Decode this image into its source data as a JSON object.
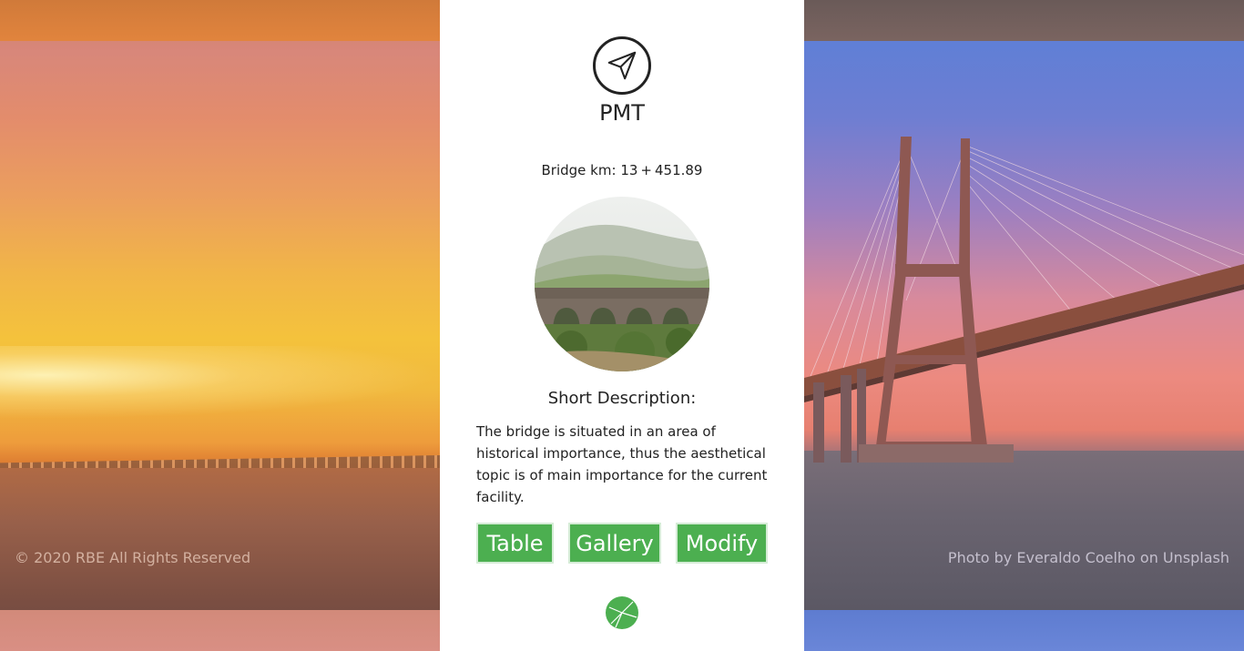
{
  "brand": {
    "name": "PMT"
  },
  "bridge": {
    "km_label": "Bridge km:",
    "km_int": "13",
    "km_sep": "+",
    "km_dec": "451.89"
  },
  "description": {
    "title": "Short Description:",
    "text": "The bridge is situated in an area of historical importance, thus the aesthetical topic is of main importance for the current facility."
  },
  "buttons": {
    "table": "Table",
    "gallery": "Gallery",
    "modify": "Modify"
  },
  "footer": {
    "copyright": "© 2020 RBE All Rights Reserved",
    "photo_credit": "Photo by Everaldo Coelho on Unsplash"
  },
  "icons": {
    "logo": "paper-plane-icon",
    "footer_logo": "green-circle-logo-icon"
  },
  "colors": {
    "accent": "#4caf50",
    "card_bg": "#ffffff",
    "text": "#222222"
  }
}
